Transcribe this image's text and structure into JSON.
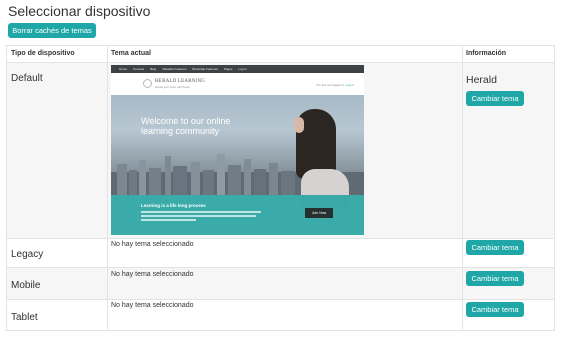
{
  "page": {
    "title": "Seleccionar dispositivo",
    "purge_button": "Borrar cachés de temas"
  },
  "table": {
    "headers": [
      "Tipo de dispositivo",
      "Tema actual",
      "Información"
    ],
    "rows": [
      {
        "device": "Default",
        "theme": "Herald",
        "button": "Cambiar tema"
      },
      {
        "device": "Legacy",
        "theme": "No hay tema seleccionado",
        "button": "Cambiar tema"
      },
      {
        "device": "Mobile",
        "theme": "No hay tema seleccionado",
        "button": "Cambiar tema"
      },
      {
        "device": "Tablet",
        "theme": "No hay tema seleccionado",
        "button": "Cambiar tema"
      }
    ]
  },
  "preview": {
    "nav_items": [
      "Home",
      "Courses",
      "Blog",
      "Valuable Features",
      "Bootstrap Features",
      "Pages",
      "Log in"
    ],
    "logo": "HERALD LEARNING",
    "logo_sub": "Moodle goes better with Herald",
    "login_prefix": "You are not logged in.",
    "login_link": "Log in",
    "hero_line1": "Welcome to our online",
    "hero_line2": "learning community",
    "band_title": "Learning is a life long process",
    "join_label": "Join Now"
  },
  "colors": {
    "accent": "#1fa6a6",
    "text": "#333333",
    "border": "#e3e3e3",
    "stripe": "#f6f6f6"
  }
}
